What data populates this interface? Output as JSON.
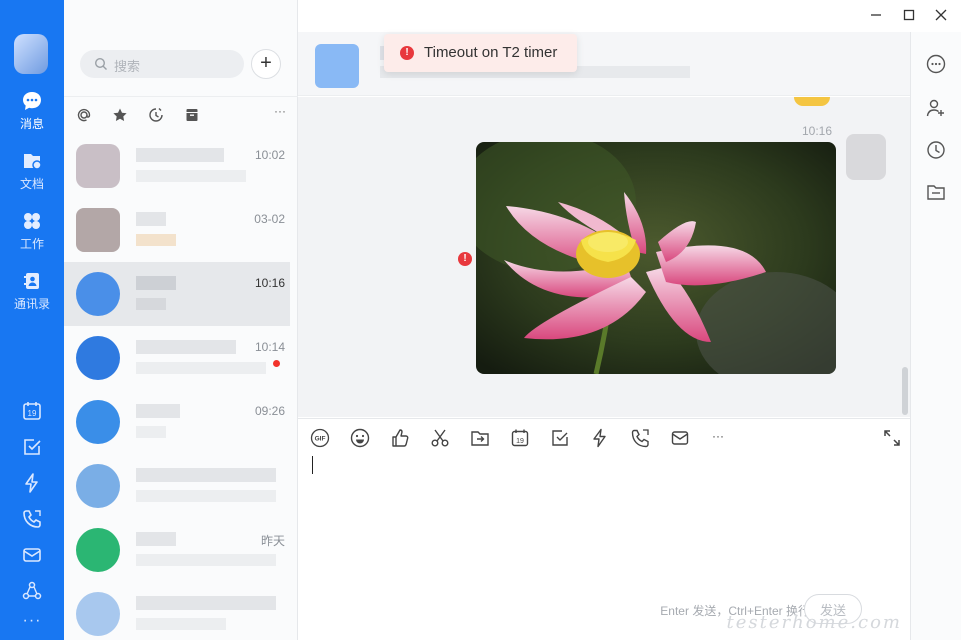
{
  "nav": {
    "items": [
      {
        "label": "消息",
        "icon": "chat-bubble-icon"
      },
      {
        "label": "文档",
        "icon": "document-icon"
      },
      {
        "label": "工作",
        "icon": "apps-grid-icon"
      },
      {
        "label": "通讯录",
        "icon": "contacts-icon"
      }
    ],
    "bottom_icons": [
      "calendar-icon",
      "task-check-icon",
      "lightning-icon",
      "phone-icon",
      "mail-icon",
      "org-network-icon",
      "more-dots-icon"
    ],
    "calendar_day": "19",
    "more": "···"
  },
  "search": {
    "placeholder": "搜索"
  },
  "add_button": "+",
  "filters": {
    "more": "···"
  },
  "conversations": [
    {
      "time": "10:02",
      "unread": false
    },
    {
      "time": "03-02",
      "unread": false
    },
    {
      "time": "10:16",
      "unread": false,
      "selected": true
    },
    {
      "time": "10:14",
      "unread": true
    },
    {
      "time": "09:26",
      "unread": false
    },
    {
      "time": "",
      "unread": false
    },
    {
      "time": "昨天",
      "unread": false
    },
    {
      "time": "",
      "unread": false
    }
  ],
  "messages": {
    "time": "10:16"
  },
  "toolbar": {
    "gif": "GIF",
    "calendar_day": "19",
    "more": "···"
  },
  "editor": {
    "hint": "Enter 发送，Ctrl+Enter 换行",
    "send_label": "发送",
    "watermark": "testerhome.com"
  },
  "toast": {
    "message": "Timeout on T2 timer"
  },
  "colors": {
    "nav_bg": "#1877f2",
    "toast_bg": "#fdecea",
    "error": "#e8383d"
  }
}
